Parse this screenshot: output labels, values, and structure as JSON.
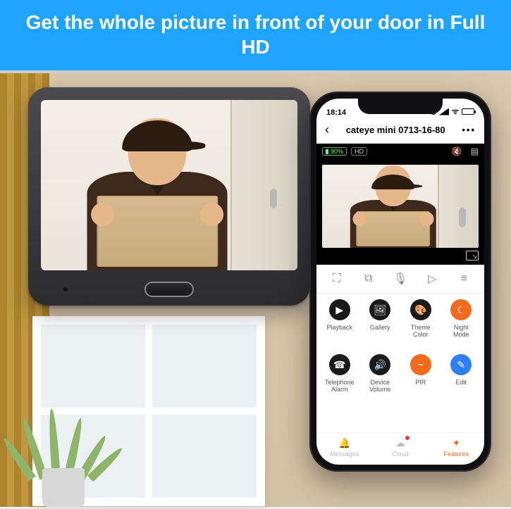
{
  "banner": {
    "headline": "Get the whole picture in front of your door in Full HD"
  },
  "statusbar": {
    "time": "18:14"
  },
  "app_header": {
    "back_glyph": "‹",
    "title": "cateye mini 0713-16-80",
    "more_glyph": "•••"
  },
  "overlay": {
    "battery_pct": "90%",
    "hd_badge": "HD",
    "mute_glyph": "✕🔊",
    "layout_glyph": "▤"
  },
  "quickbar": {
    "fullscreen": "⛶",
    "snapshot": "⧉",
    "mic": "🎙",
    "record": "▷",
    "menu": "≡"
  },
  "tiles": [
    {
      "icon": "▶",
      "cls": "black",
      "label": "Playback"
    },
    {
      "icon": "🖼",
      "cls": "black",
      "label": "Gallery"
    },
    {
      "icon": "🎨",
      "cls": "black",
      "label": "Theme Color"
    },
    {
      "icon": "☾",
      "cls": "orange",
      "label": "Night Mode"
    },
    {
      "icon": "☎",
      "cls": "black",
      "label": "Telephone Alarm"
    },
    {
      "icon": "🔊",
      "cls": "black",
      "label": "Device Volume"
    },
    {
      "icon": "~",
      "cls": "orange",
      "label": "PIR"
    },
    {
      "icon": "✎",
      "cls": "blue",
      "label": "Edit"
    }
  ],
  "bottom_nav": [
    {
      "icon": "🔔",
      "label": "Messages",
      "active": false,
      "badge": false
    },
    {
      "icon": "☁",
      "label": "Cloud",
      "active": false,
      "badge": true
    },
    {
      "icon": "✦",
      "label": "Features",
      "active": true,
      "badge": false
    }
  ]
}
